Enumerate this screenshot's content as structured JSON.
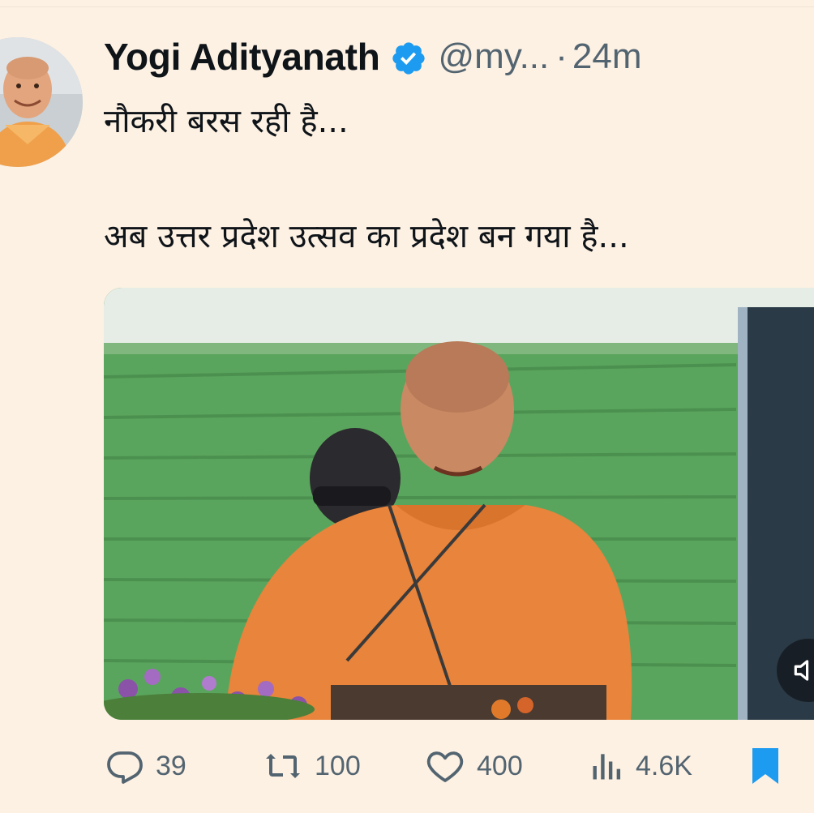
{
  "tweet": {
    "author_name": "Yogi Adityanath",
    "handle": "@my...",
    "separator": "·",
    "time": "24m",
    "verified": true,
    "text_line1": "नौकरी बरस रही है...",
    "text_line2": "अब उत्तर प्रदेश उत्सव का प्रदेश बन गया है..."
  },
  "media": {
    "type": "video",
    "icon": "volume-icon"
  },
  "actions": {
    "reply": {
      "icon": "reply-icon",
      "count": "39"
    },
    "retweet": {
      "icon": "retweet-icon",
      "count": "100"
    },
    "like": {
      "icon": "heart-icon",
      "count": "400"
    },
    "views": {
      "icon": "views-icon",
      "count": "4.6K"
    },
    "bookmark": {
      "icon": "bookmark-icon",
      "active": true
    }
  },
  "colors": {
    "background": "#fdf1e3",
    "text": "#0f1419",
    "secondary_text": "#536471",
    "verified_blue": "#1d9bf0",
    "bookmark_blue": "#1d9bf0"
  }
}
